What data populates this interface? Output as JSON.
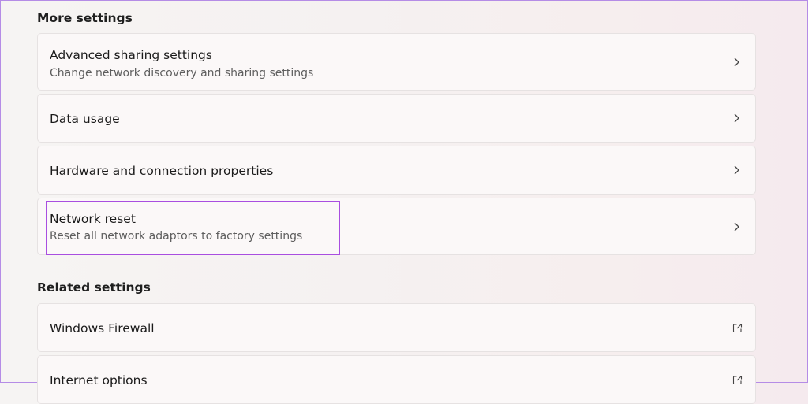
{
  "more_settings": {
    "heading": "More settings",
    "items": [
      {
        "title": "Advanced sharing settings",
        "subtitle": "Change network discovery and sharing settings",
        "icon": "chevron-right-icon"
      },
      {
        "title": "Data usage",
        "icon": "chevron-right-icon"
      },
      {
        "title": "Hardware and connection properties",
        "icon": "chevron-right-icon"
      },
      {
        "title": "Network reset",
        "subtitle": "Reset all network adaptors to factory settings",
        "icon": "chevron-right-icon"
      }
    ]
  },
  "related_settings": {
    "heading": "Related settings",
    "items": [
      {
        "title": "Windows Firewall",
        "icon": "external-link-icon"
      },
      {
        "title": "Internet options",
        "icon": "external-link-icon"
      }
    ]
  },
  "colors": {
    "highlight": "#a94ee0",
    "card_background": "#fbf8f8",
    "border": "#b58ce6"
  }
}
